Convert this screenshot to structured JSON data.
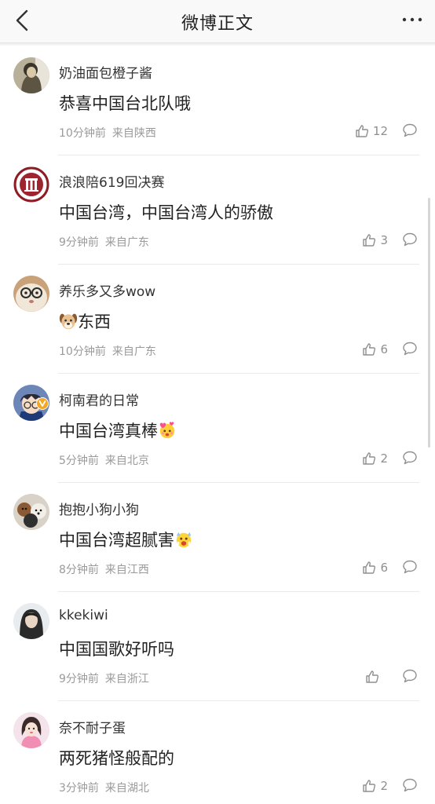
{
  "nav": {
    "title": "微博正文",
    "back_icon": "chevron-left-icon",
    "more_icon": "more-dots-icon"
  },
  "comments": [
    {
      "user": "奶油面包橙子酱",
      "text": "恭喜中国台北队哦",
      "time": "10分钟前",
      "source": "来自陕西",
      "likes": "12",
      "avatar": "person-sketch-avatar"
    },
    {
      "user": "浪浪陪619回决赛",
      "text": "中国台湾，中国台湾人的骄傲",
      "time": "9分钟前",
      "source": "来自广东",
      "likes": "3",
      "avatar": "red-emblem-avatar"
    },
    {
      "user": "养乐多又多wow",
      "text": "东西",
      "emoji": "dog-face-icon",
      "time": "10分钟前",
      "source": "来自广东",
      "likes": "6",
      "avatar": "glasses-cat-avatar"
    },
    {
      "user": "柯南君的日常",
      "text": "中国台湾真棒",
      "emoji": "heart-face-icon",
      "time": "5分钟前",
      "source": "来自北京",
      "likes": "2",
      "avatar": "anime-boy-avatar",
      "verified": true
    },
    {
      "user": "抱抱小狗小狗",
      "text": "中国台湾超腻害",
      "emoji": "shocked-face-icon",
      "time": "8分钟前",
      "source": "来自江西",
      "likes": "6",
      "avatar": "plush-toys-avatar"
    },
    {
      "user": "kkekiwi",
      "text": "中国国歌好听吗",
      "time": "9分钟前",
      "source": "来自浙江",
      "likes": "",
      "avatar": "dark-hair-girl-avatar"
    },
    {
      "user": "奈不耐子蛋",
      "text": "两死猪怪般配的",
      "time": "3分钟前",
      "source": "来自湖北",
      "likes": "2",
      "avatar": "pink-girl-avatar"
    }
  ],
  "colors": {
    "text_primary": "#222222",
    "text_meta": "#9a9a9a",
    "icon": "#8f8f8f",
    "verified": "#f5a623"
  }
}
